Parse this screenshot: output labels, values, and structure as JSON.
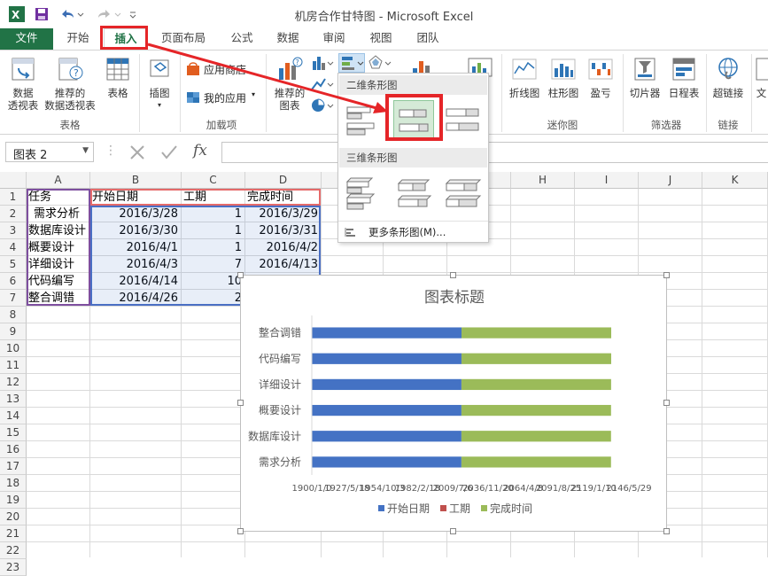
{
  "window": {
    "title": "机房合作甘特图 - Microsoft Excel"
  },
  "tabs": [
    "文件",
    "开始",
    "插入",
    "页面布局",
    "公式",
    "数据",
    "审阅",
    "视图",
    "团队"
  ],
  "ribbon": {
    "pivot_table": "数据\n透视表",
    "pivot_table_l1": "数据",
    "pivot_table_l2": "透视表",
    "rec_pivot_l1": "推荐的",
    "rec_pivot_l2": "数据透视表",
    "table": "表格",
    "group_tables": "表格",
    "illustrations": "插图",
    "app_store": "应用商店",
    "my_apps": "我的应用",
    "group_addins": "加载项",
    "rec_charts_l1": "推荐的",
    "rec_charts_l2": "图表",
    "line": "折线图",
    "column": "柱形图",
    "winloss": "盈亏",
    "group_sparklines": "迷你图",
    "slicer": "切片器",
    "timeline": "日程表",
    "group_filters": "筛选器",
    "hyperlink": "超链接",
    "group_links": "链接",
    "text_partial": "文"
  },
  "formula_bar": {
    "name_box": "图表 2",
    "fx": "fx"
  },
  "dropdown": {
    "header_2d": "二维条形图",
    "header_3d": "三维条形图",
    "more": "更多条形图(M)..."
  },
  "grid": {
    "columns": [
      "A",
      "B",
      "C",
      "D",
      "E",
      "F",
      "G",
      "H",
      "I",
      "J",
      "K"
    ],
    "rows": [
      "1",
      "2",
      "3",
      "4",
      "5",
      "6",
      "7",
      "8",
      "9",
      "10",
      "11",
      "12",
      "13",
      "14",
      "15",
      "16",
      "17",
      "18",
      "19",
      "20",
      "21",
      "22",
      "23"
    ],
    "data": [
      [
        "任务",
        "开始日期",
        "工期",
        "完成时间"
      ],
      [
        "需求分析",
        "2016/3/28",
        "1",
        "2016/3/29"
      ],
      [
        "数据库设计",
        "2016/3/30",
        "1",
        "2016/3/31"
      ],
      [
        "概要设计",
        "2016/4/1",
        "1",
        "2016/4/2"
      ],
      [
        "详细设计",
        "2016/4/3",
        "7",
        "2016/4/13"
      ],
      [
        "代码编写",
        "2016/4/14",
        "10",
        ""
      ],
      [
        "整合调错",
        "2016/4/26",
        "2",
        ""
      ]
    ]
  },
  "chart_data": {
    "type": "bar",
    "title": "图表标题",
    "categories": [
      "需求分析",
      "数据库设计",
      "概要设计",
      "详细设计",
      "代码编写",
      "整合调错"
    ],
    "series": [
      {
        "name": "开始日期",
        "color": "#4472c4",
        "values": [
          42457,
          42459,
          42461,
          42463,
          42474,
          42486
        ]
      },
      {
        "name": "工期",
        "color": "#c0504d",
        "values": [
          1,
          1,
          1,
          7,
          10,
          2
        ]
      },
      {
        "name": "完成时间",
        "color": "#9bbb59",
        "values": [
          42458,
          42460,
          42462,
          42473,
          42484,
          42488
        ]
      }
    ],
    "xlim": [
      0,
      90000
    ],
    "x_tick_labels": [
      "1900/1/0",
      "1927/5/18",
      "1954/10/3",
      "1982/2/18",
      "2009/7/6",
      "2036/11/20",
      "2064/4/8",
      "2091/8/25",
      "2119/1/10",
      "2146/5/29"
    ],
    "legend": "bottom",
    "grid": false
  }
}
